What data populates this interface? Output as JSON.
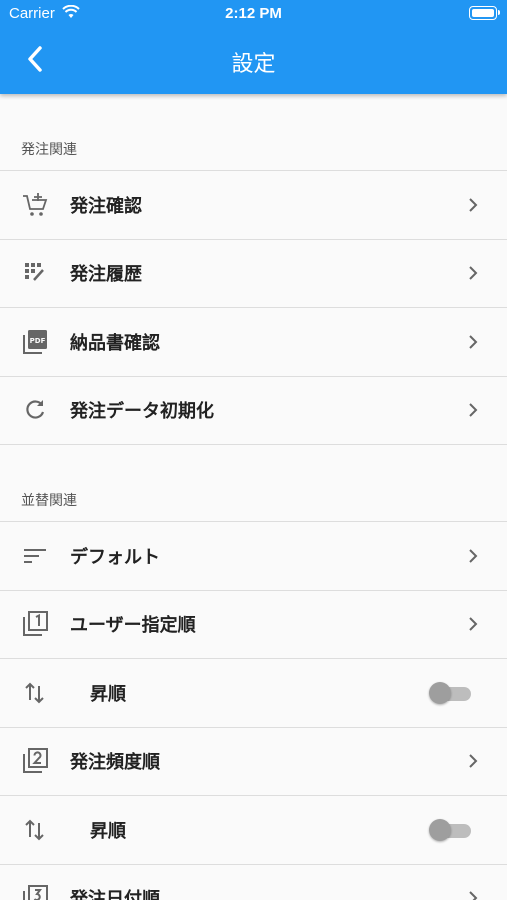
{
  "status_bar": {
    "carrier": "Carrier",
    "time": "2:12 PM"
  },
  "header": {
    "title": "設定"
  },
  "sections": [
    {
      "title": "発注関連",
      "items": [
        {
          "label": "発注確認",
          "icon": "cart-add-icon"
        },
        {
          "label": "発注履歴",
          "icon": "history-grid-icon"
        },
        {
          "label": "納品書確認",
          "icon": "pdf-icon"
        },
        {
          "label": "発注データ初期化",
          "icon": "refresh-icon"
        }
      ]
    },
    {
      "title": "並替関連",
      "items": [
        {
          "label": "デフォルト",
          "icon": "sort-lines-icon"
        },
        {
          "label": "ユーザー指定順",
          "icon": "filter-1-icon"
        },
        {
          "label": "昇順",
          "icon": "swap-vert-icon",
          "toggle": false
        },
        {
          "label": "発注頻度順",
          "icon": "filter-2-icon"
        },
        {
          "label": "昇順",
          "icon": "swap-vert-icon",
          "toggle": false
        },
        {
          "label": "発注日付順",
          "icon": "filter-3-icon"
        }
      ]
    }
  ],
  "colors": {
    "primary": "#2196f3",
    "toggle_off": "#9e9e9e"
  }
}
